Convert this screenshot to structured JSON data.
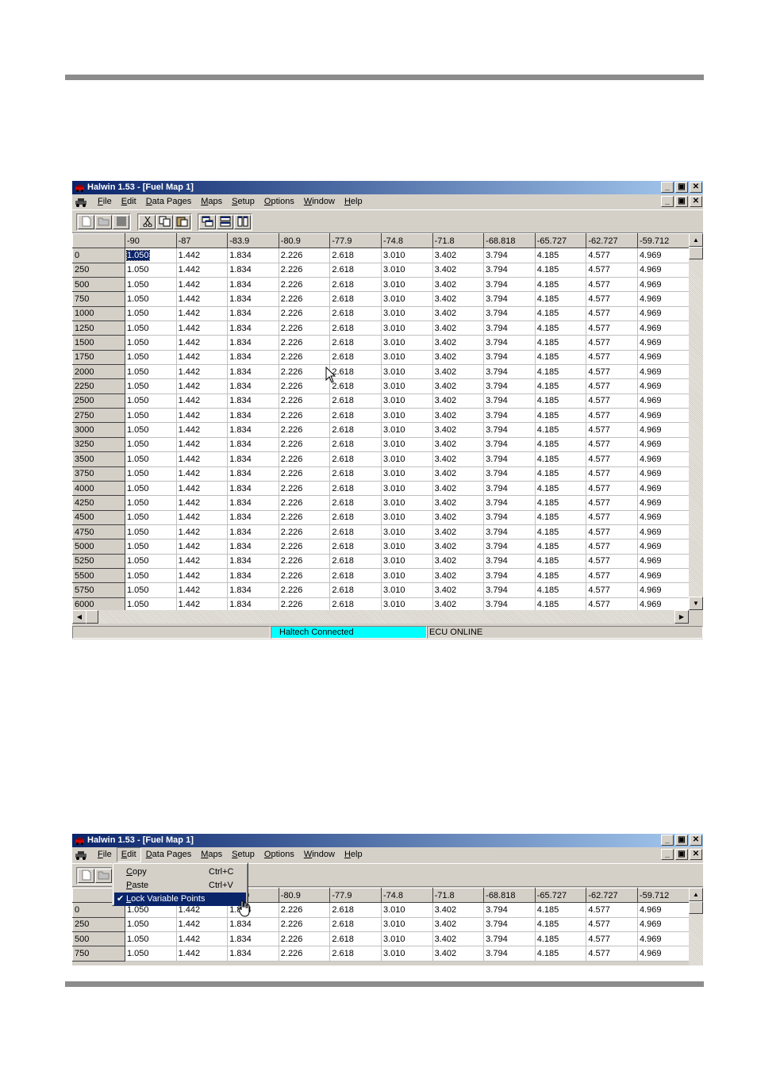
{
  "app": {
    "title": "Halwin 1.53 - [Fuel Map 1]",
    "menu": [
      "File",
      "Edit",
      "Data Pages",
      "Maps",
      "Setup",
      "Options",
      "Window",
      "Help"
    ],
    "window_controls": [
      "_",
      "🗗",
      "✕"
    ]
  },
  "grid": {
    "columns": [
      "-90",
      "-87",
      "-83.9",
      "-80.9",
      "-77.9",
      "-74.8",
      "-71.8",
      "-68.818",
      "-65.727",
      "-62.727",
      "-59.712"
    ],
    "row_values": [
      "1.050",
      "1.442",
      "1.834",
      "2.226",
      "2.618",
      "3.010",
      "3.402",
      "3.794",
      "4.185",
      "4.577",
      "4.969"
    ],
    "rows": [
      "0",
      "250",
      "500",
      "750",
      "1000",
      "1250",
      "1500",
      "1750",
      "2000",
      "2250",
      "2500",
      "2750",
      "3000",
      "3250",
      "3500",
      "3750",
      "4000",
      "4250",
      "4500",
      "4750",
      "5000",
      "5250",
      "5500",
      "5750",
      "6000"
    ],
    "rows_short": [
      "0",
      "250",
      "500",
      "750"
    ]
  },
  "status": {
    "connection": "Haltech Connected",
    "ecu": "ECU ONLINE"
  },
  "edit_menu": {
    "items": [
      {
        "label": "Copy",
        "shortcut": "Ctrl+C"
      },
      {
        "label": "Paste",
        "shortcut": "Ctrl+V"
      },
      {
        "label": "Lock Variable Points",
        "shortcut": ""
      }
    ]
  },
  "colors": {
    "title_start": "#0a246a",
    "title_end": "#a6caf0",
    "status_cyan": "#00ffff",
    "face": "#d4d0c8"
  },
  "icons": [
    "new-icon",
    "open-icon",
    "save-icon",
    "cut-icon",
    "copy-icon",
    "paste-icon",
    "cascade-icon",
    "tile-horizontal-icon",
    "tile-vertical-icon"
  ]
}
